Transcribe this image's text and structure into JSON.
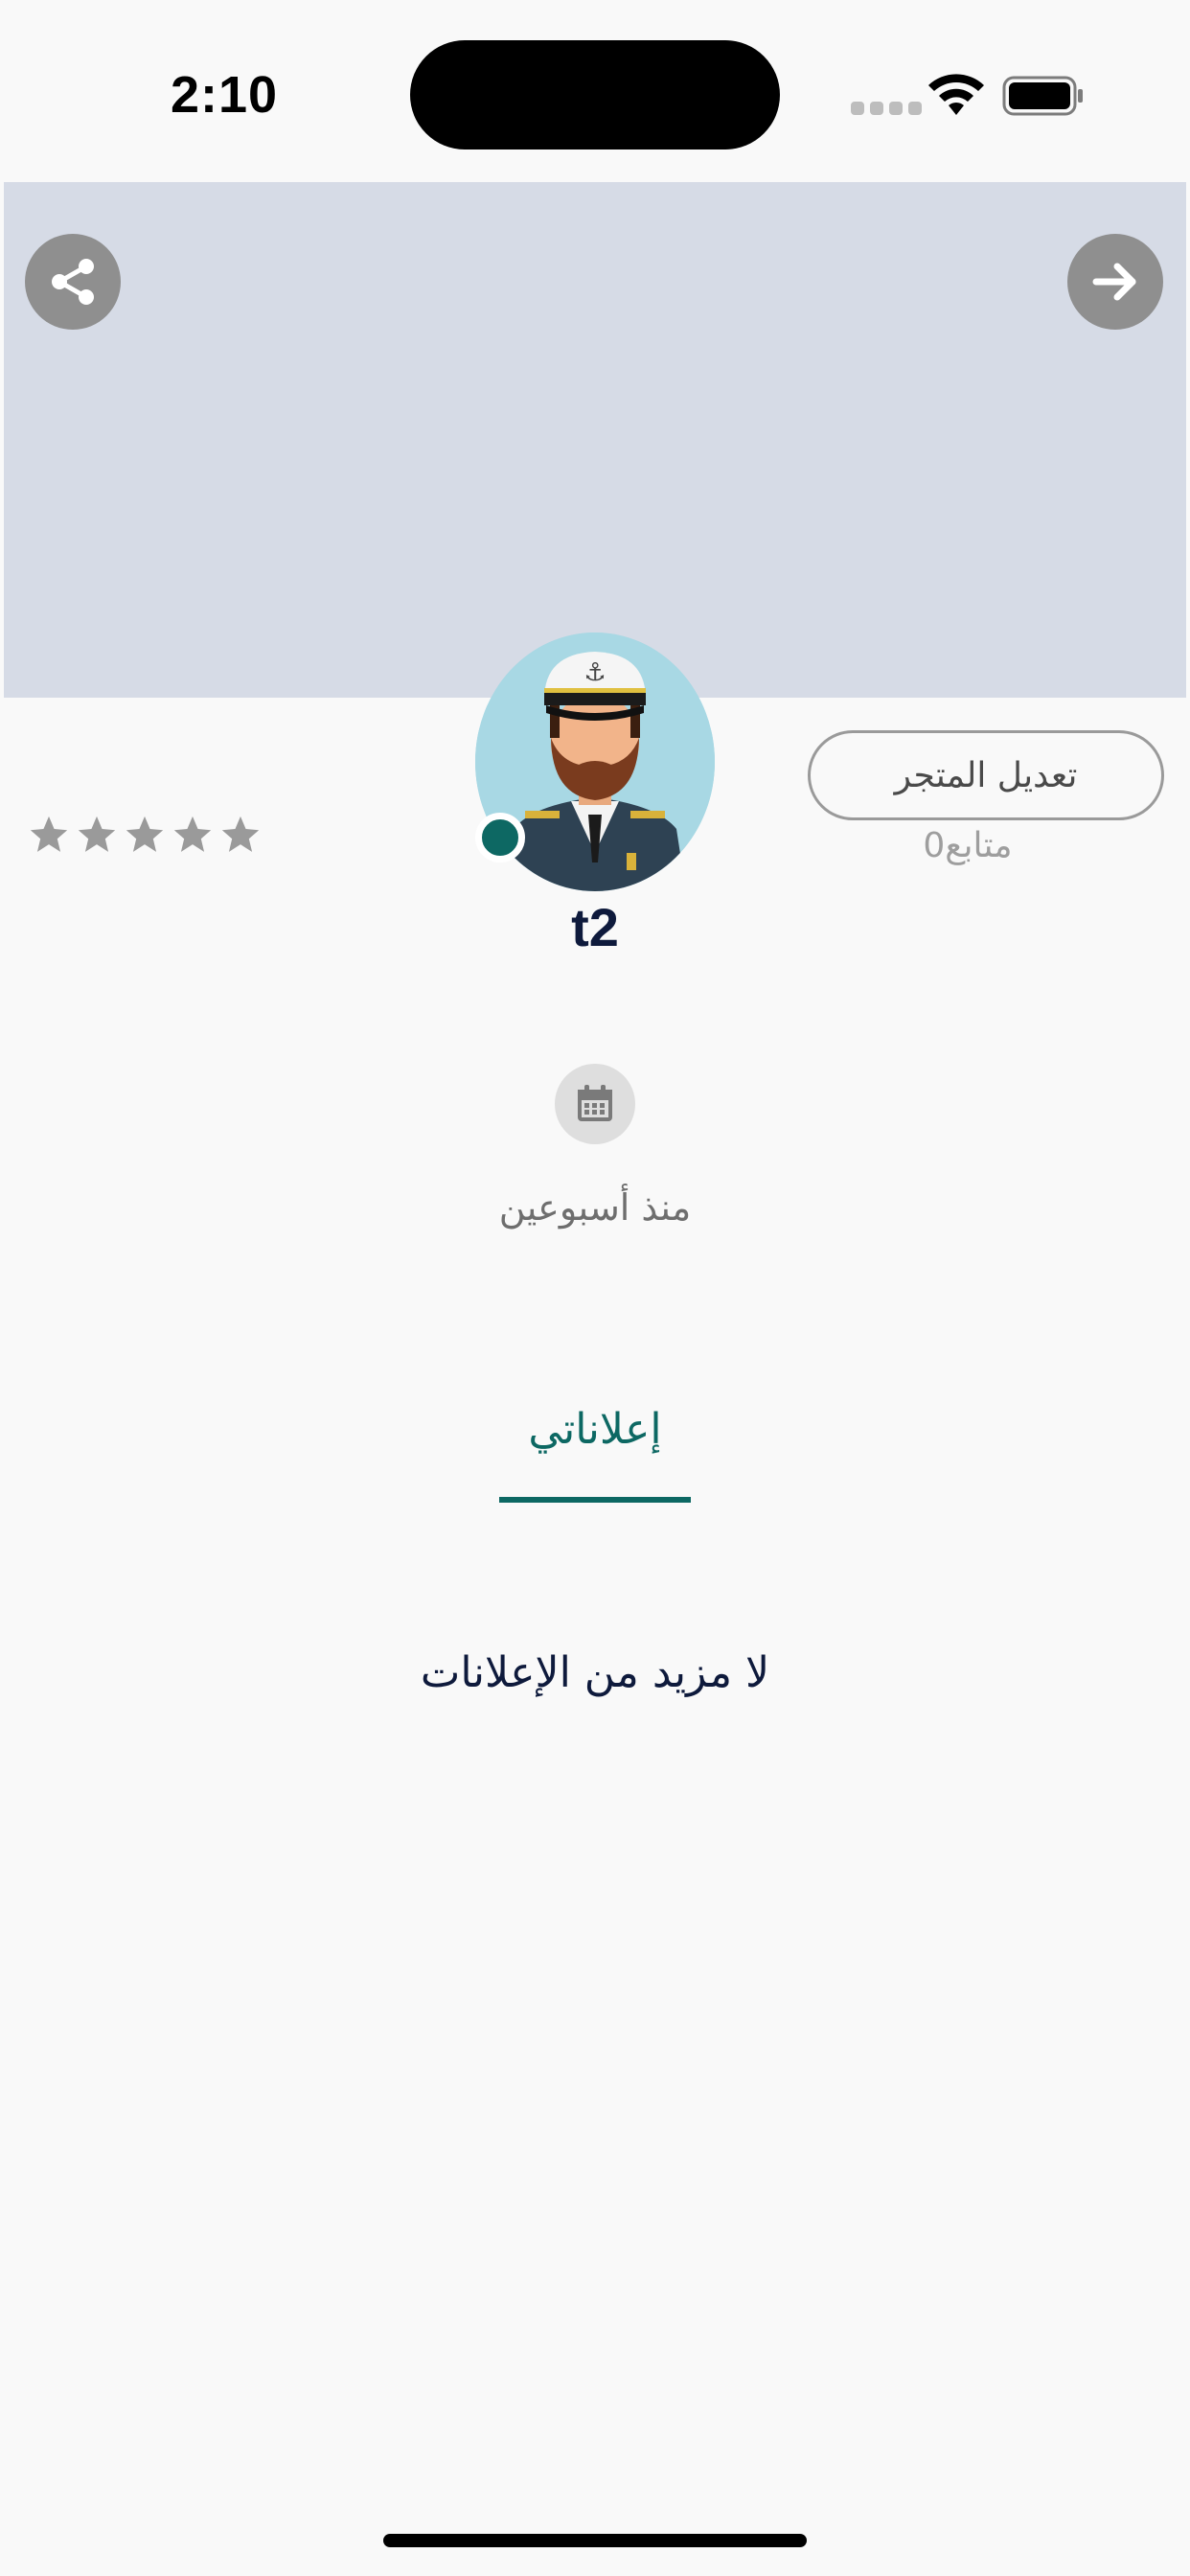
{
  "status_bar": {
    "time": "2:10",
    "icons": [
      "signal-icon",
      "wifi-icon",
      "battery-icon"
    ]
  },
  "cover": {
    "share_icon": "share-icon",
    "back_icon": "arrow-right-icon",
    "background_color": "#d6dbe6"
  },
  "profile": {
    "edit_store_label": "تعديل المتجر",
    "followers_text": "متابع0",
    "username": "t2",
    "rating_stars": 5,
    "online": true,
    "online_color": "#0d6863"
  },
  "joined": {
    "icon": "calendar-icon",
    "text": "منذ أسبوعين"
  },
  "tabs": [
    {
      "label": "إعلاناتي",
      "active": true
    }
  ],
  "ads": {
    "empty_message": "لا مزيد من الإعلانات"
  },
  "colors": {
    "accent": "#0d6863",
    "title": "#0e1a3c",
    "muted": "#9e9e9e"
  }
}
